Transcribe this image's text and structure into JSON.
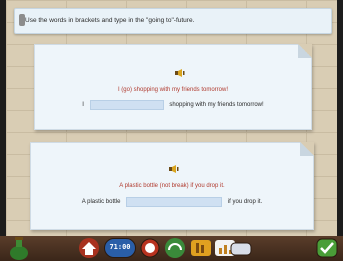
{
  "instruction": "Use the words in brackets and type in the \"going to\"-future.",
  "exercises": [
    {
      "prompt": "I (go) shopping with my friends tomorrow!",
      "prefix": "I",
      "suffix": "shopping with my friends tomorrow!",
      "answer_value": ""
    },
    {
      "prompt": "A plastic bottle (not break) if you drop it.",
      "prefix": "A plastic bottle",
      "suffix": "if you drop it.",
      "answer_value": ""
    }
  ],
  "toolbar": {
    "timer": "71:00"
  },
  "colors": {
    "prompt_red": "#b03a2e",
    "input_blue": "#cfe0f2",
    "card_bg": "#eef5fa"
  }
}
